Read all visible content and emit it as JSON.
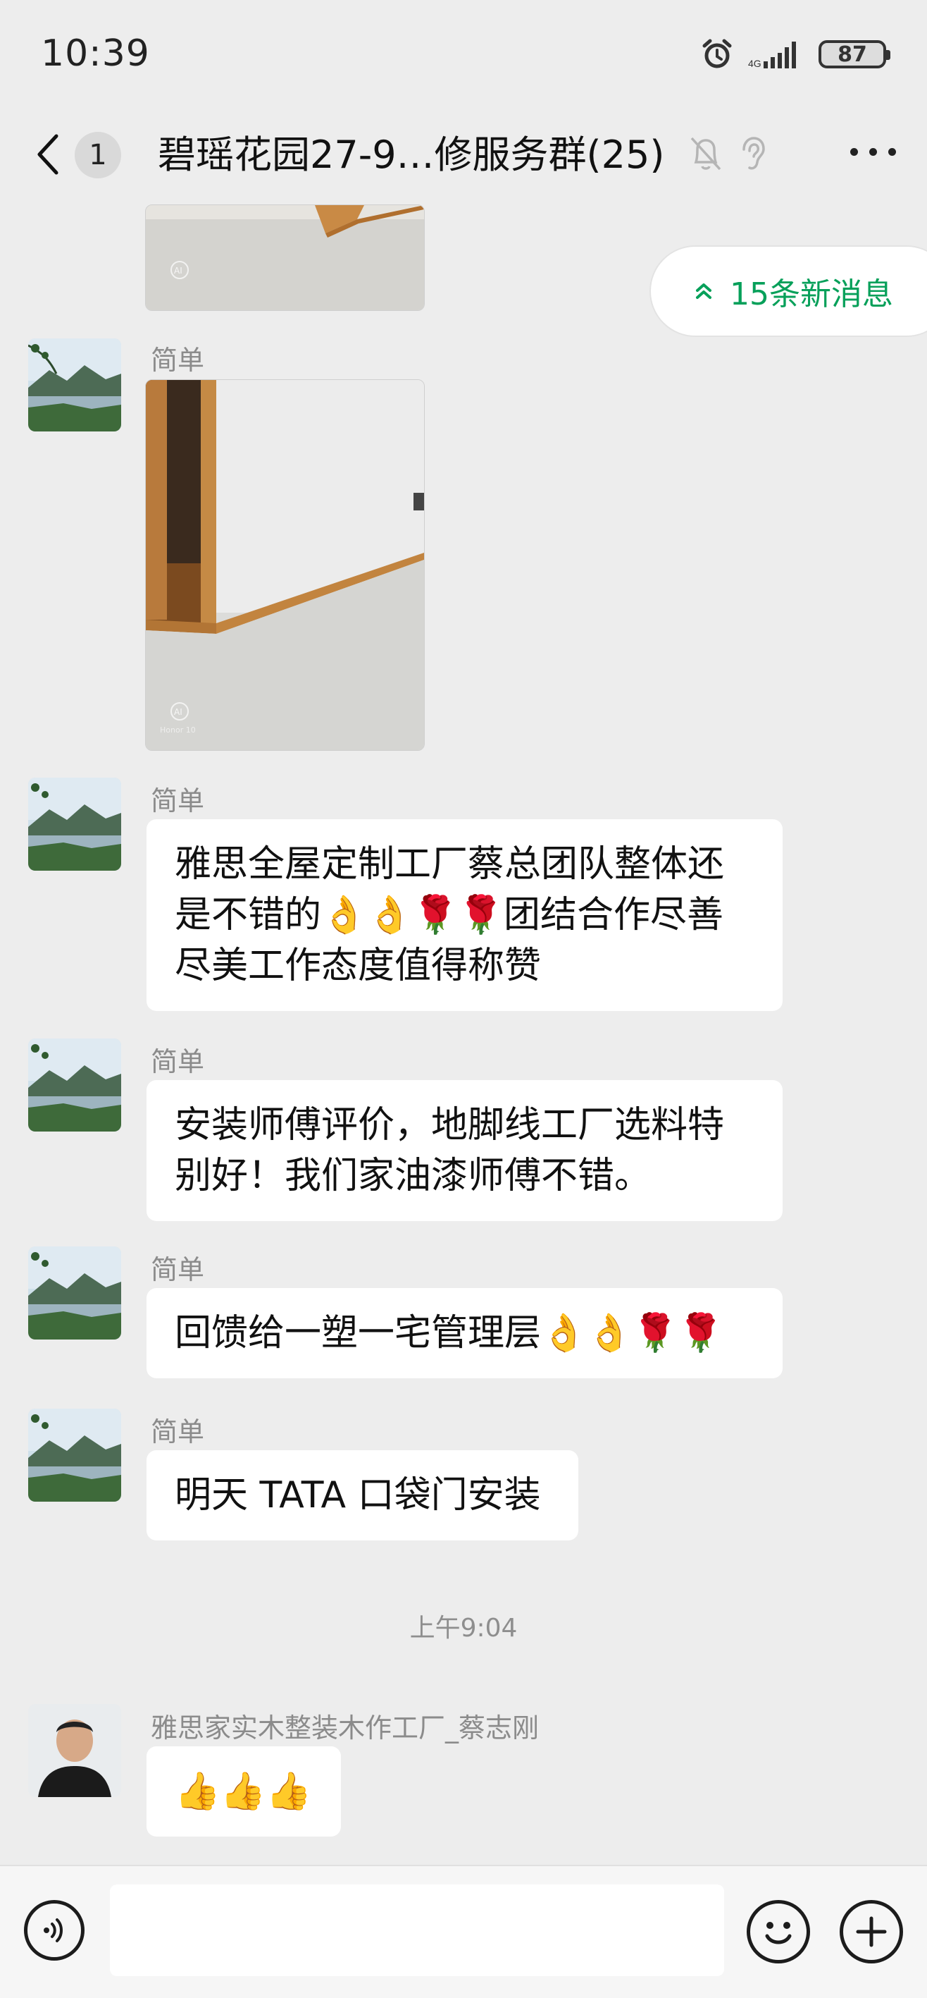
{
  "status_bar": {
    "time": "10:39",
    "battery": "87"
  },
  "nav": {
    "unread_count": "1",
    "title": "碧瑶花园27-9…修服务群(25)"
  },
  "new_messages": {
    "label": "15条新消息"
  },
  "messages": [
    {
      "sender": "简单",
      "type": "image"
    },
    {
      "sender": "简单",
      "type": "text",
      "text": "雅思全屋定制工厂蔡总团队整体还是不错的👌👌🌹🌹团结合作尽善尽美工作态度值得称赞"
    },
    {
      "sender": "简单",
      "type": "text",
      "text": "安装师傅评价，地脚线工厂选料特别好！我们家油漆师傅不错。"
    },
    {
      "sender": "简单",
      "type": "text",
      "text": "回馈给一塑一宅管理层👌👌🌹🌹"
    },
    {
      "sender": "简单",
      "type": "text",
      "text": "明天 TATA 口袋门安装"
    },
    {
      "type": "timestamp",
      "text": "上午9:04"
    },
    {
      "sender": "雅思家实木整装木作工厂_蔡志刚",
      "type": "text",
      "text": "👍👍👍"
    }
  ],
  "icons": {
    "back": "chevron-left-icon",
    "mute": "bell-off-icon",
    "ear": "ear-icon",
    "more": "more-dots-icon",
    "voice": "voice-icon",
    "emoji": "emoji-icon",
    "plus": "plus-icon"
  },
  "colors": {
    "accent_green": "#07a05a",
    "background": "#ededed"
  }
}
